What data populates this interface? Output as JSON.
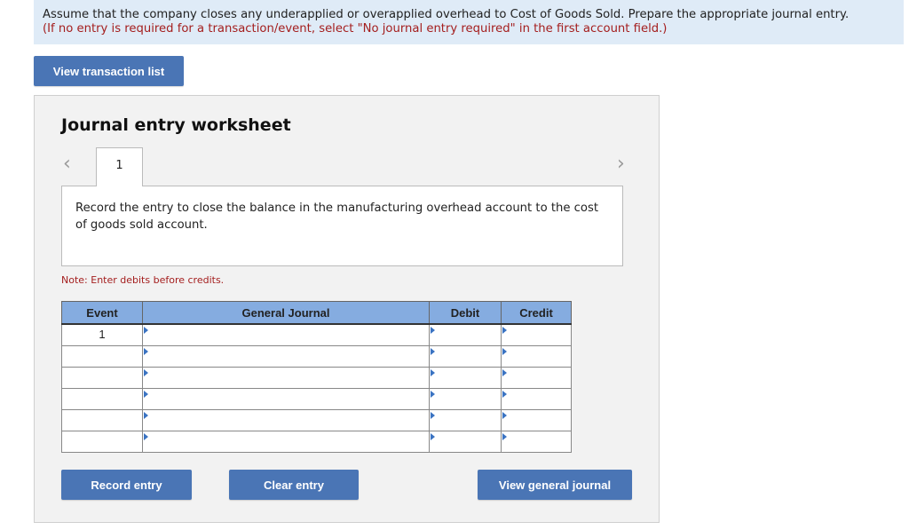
{
  "instructions": {
    "line1": "Assume that the company closes any underapplied or overapplied overhead to Cost of Goods Sold. Prepare the appropriate journal entry.",
    "line2": "(If no entry is required for a transaction/event, select \"No journal entry required\" in the first account field.)"
  },
  "buttons": {
    "view_transaction_list": "View transaction list",
    "record_entry": "Record entry",
    "clear_entry": "Clear entry",
    "view_general_journal": "View general journal"
  },
  "worksheet": {
    "title": "Journal entry worksheet",
    "prev_icon": "‹",
    "next_icon": "›",
    "active_tab": "1",
    "description": "Record the entry to close the balance in the manufacturing overhead account to the cost of goods sold account.",
    "note": "Note: Enter debits before credits."
  },
  "table": {
    "headers": [
      "Event",
      "General Journal",
      "Debit",
      "Credit"
    ],
    "rows": [
      {
        "event": "1",
        "account": "",
        "debit": "",
        "credit": ""
      },
      {
        "event": "",
        "account": "",
        "debit": "",
        "credit": ""
      },
      {
        "event": "",
        "account": "",
        "debit": "",
        "credit": ""
      },
      {
        "event": "",
        "account": "",
        "debit": "",
        "credit": ""
      },
      {
        "event": "",
        "account": "",
        "debit": "",
        "credit": ""
      },
      {
        "event": "",
        "account": "",
        "debit": "",
        "credit": ""
      }
    ]
  },
  "colors": {
    "button_bg": "#4a75b5",
    "header_bg": "#85ace0",
    "instruction_bg": "#dfebf7",
    "note_red": "#a41e1e"
  }
}
